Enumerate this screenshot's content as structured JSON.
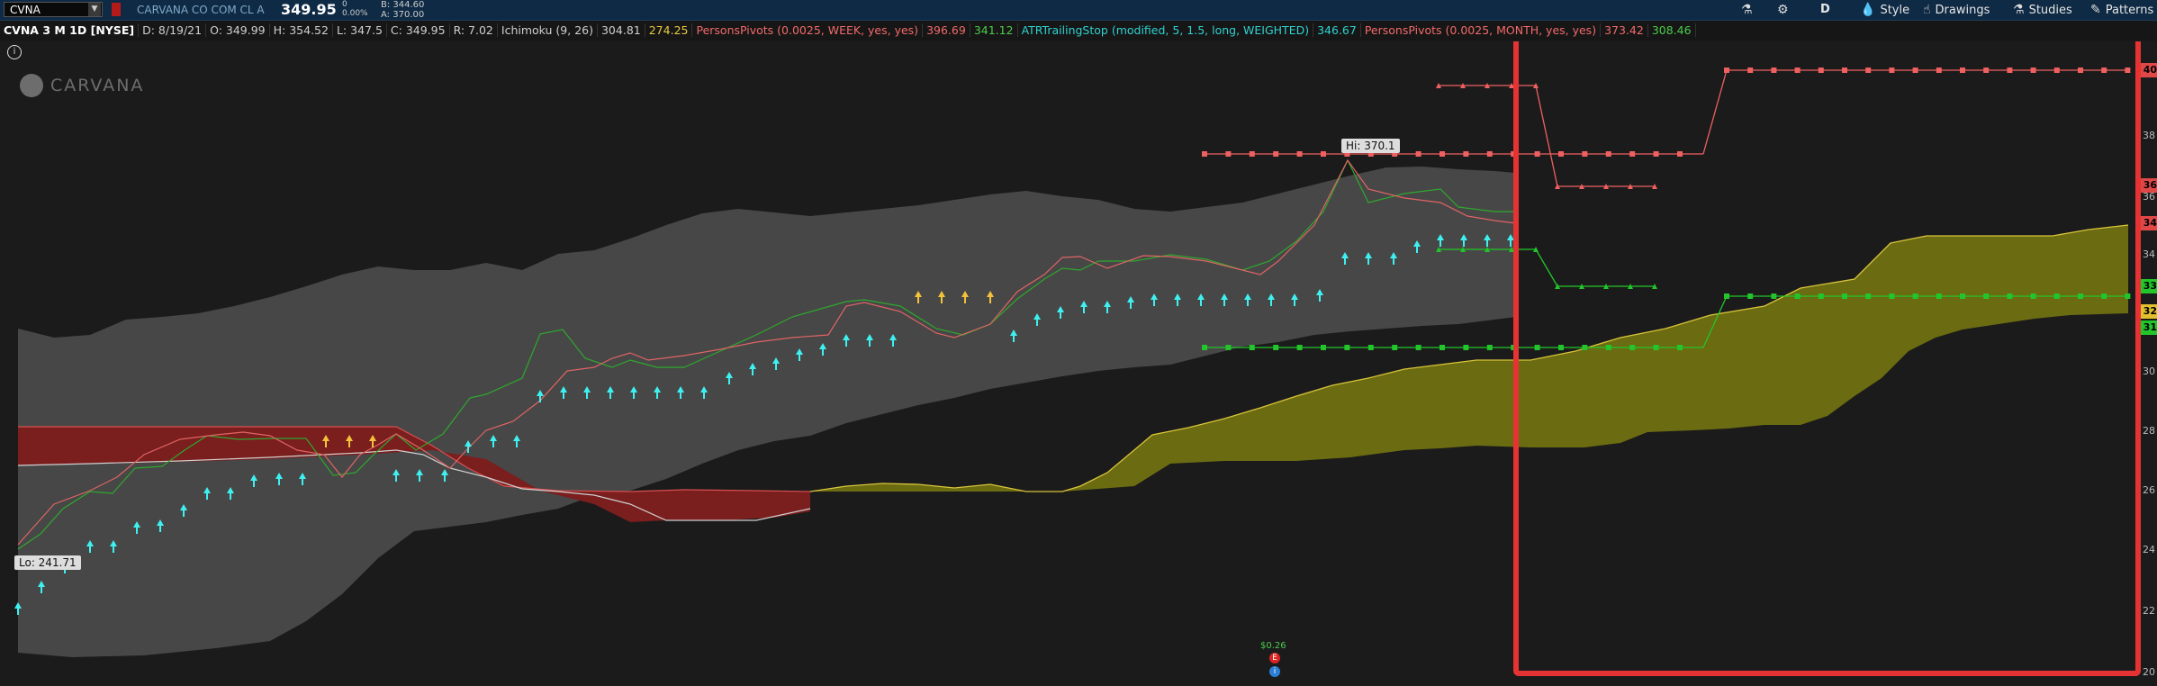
{
  "header": {
    "symbol": "CVNA",
    "company": "CARVANA CO COM CL A",
    "last": "349.95",
    "change": "0",
    "change_pct": "0.00%",
    "bid": "B: 344.60",
    "ask": "A: 370.00"
  },
  "toolbar": {
    "period": "D",
    "style": "Style",
    "drawings": "Drawings",
    "studies": "Studies",
    "patterns": "Patterns"
  },
  "info": {
    "title": "CVNA 3 M 1D [NYSE]",
    "date": "D: 8/19/21",
    "open": "O: 349.99",
    "high": "H: 354.52",
    "low": "L: 347.5",
    "close": "C: 349.95",
    "range": "R: 7.02",
    "ichimoku": "Ichimoku (9, 26)",
    "ichimoku_v1": "304.81",
    "ichimoku_v2": "274.25",
    "pivots_week": "PersonsPivots (0.0025, WEEK, yes, yes)",
    "pivots_week_v1": "396.69",
    "pivots_week_v2": "341.12",
    "atr": "ATRTrailingStop (modified, 5, 1.5, long, WEIGHTED)",
    "atr_v": "346.67",
    "pivots_month": "PersonsPivots (0.0025, MONTH, yes, yes)",
    "pivots_month_v1": "373.42",
    "pivots_month_v2": "308.46"
  },
  "logo": {
    "text": "CARVANA"
  },
  "callouts": {
    "hi": "Hi: 370.1",
    "lo": "Lo: 241.71"
  },
  "events": {
    "dividend": "$0.26",
    "earnings": "E",
    "info": "i"
  },
  "axis_labels": [
    {
      "text": "38"
    },
    {
      "text": "36"
    },
    {
      "text": "34"
    },
    {
      "text": "32"
    },
    {
      "text": "30"
    },
    {
      "text": "28"
    },
    {
      "text": "26"
    },
    {
      "text": "24"
    },
    {
      "text": "22"
    },
    {
      "text": "20"
    }
  ],
  "price_boxes": [
    {
      "text": "40",
      "color": "#e04848"
    },
    {
      "text": "36",
      "color": "#e04848"
    },
    {
      "text": "34",
      "color": "#e04848"
    },
    {
      "text": "33",
      "color": "#22c52a"
    },
    {
      "text": "32",
      "color": "#e0c02e"
    },
    {
      "text": "31",
      "color": "#22c52a"
    }
  ],
  "colors": {
    "cloud_gray": "#4a4a4a",
    "kumo_red": "#7a1e1e",
    "kumo_yellow": "#6b6b12",
    "tenkan": "#e06464",
    "kijun": "#2ea82e",
    "pivot_red": "#f06060",
    "pivot_green": "#22c52a",
    "arrow_cyan": "#3ff0f0",
    "arrow_yellow": "#f2c23a",
    "highlight": "#e53333"
  }
}
